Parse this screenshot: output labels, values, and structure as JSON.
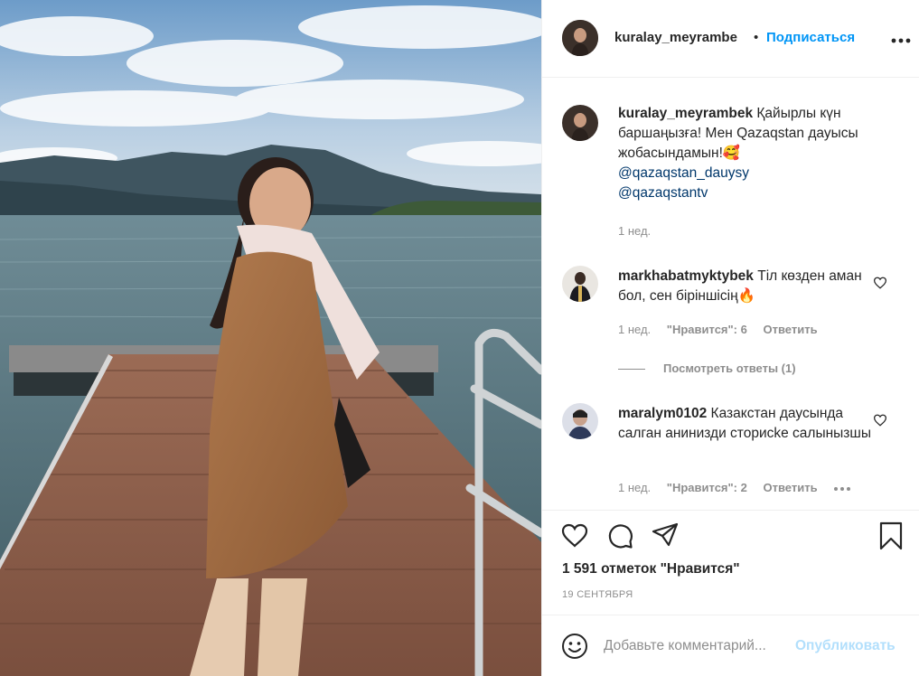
{
  "header": {
    "username": "kuralay_meyrambe",
    "separator": "•",
    "follow_label": "Подписаться",
    "more_icon": "more-horizontal-icon"
  },
  "caption": {
    "username": "kuralay_meyrambek",
    "text": " Қайырлы күн баршаңызға! Мен Qazaqstan дауысы жобасындамын!🥰",
    "mentions": [
      "@qazaqstan_dauysy",
      "@qazaqstantv"
    ],
    "time": "1 нед."
  },
  "comments": [
    {
      "username": "markhabatmyktybek",
      "text": " Тіл көзден аман бол, сен біріншісің🔥",
      "time": "1 нед.",
      "likes": "\"Нравится\": 6",
      "reply": "Ответить",
      "view_replies": "Посмотреть ответы (1)"
    },
    {
      "username": "maralym0102",
      "text": " Казакстан даусында салган анинизди сторисke салынызшы",
      "time": "1 нед.",
      "likes": "\"Нравится\": 2",
      "reply": "Ответить"
    }
  ],
  "actions": {
    "icons": [
      "heart-icon",
      "comment-icon",
      "share-icon",
      "bookmark-icon"
    ],
    "likes": "1 591 отметок \"Нравится\"",
    "date": "19 СЕНТЯБРЯ"
  },
  "add_comment": {
    "placeholder": "Добавьте комментарий...",
    "publish_label": "Опубликовать"
  },
  "colors": {
    "link": "#0095f6",
    "mention": "#00376b",
    "secondary": "#8e8e8e",
    "publish_disabled": "#b2dffc"
  }
}
